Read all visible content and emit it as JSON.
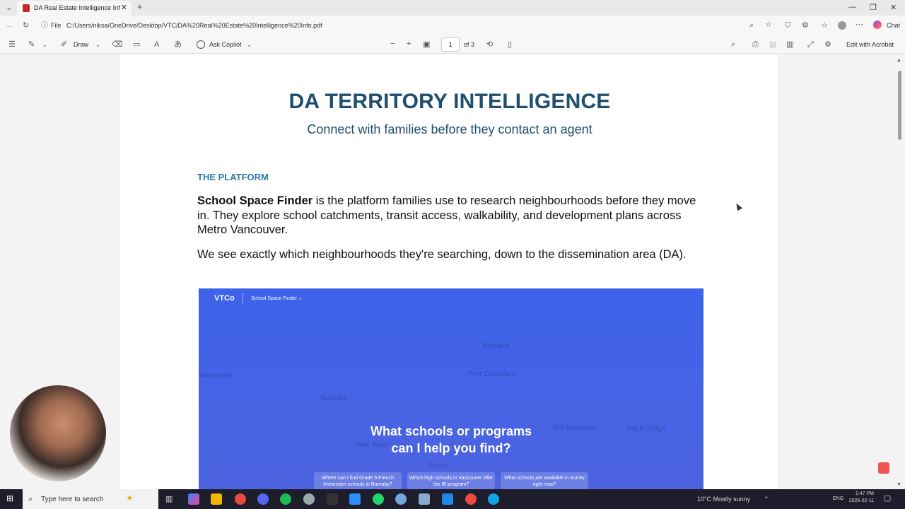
{
  "browser": {
    "tab_title": "DA Real Estate Intelligence Info.p",
    "tab_close": "✕",
    "new_tab": "+",
    "address_prefix": "File",
    "address_url": "C:/Users/niksa/OneDrive/Desktop/VTC/DA%20Real%20Estate%20Intelligence%20Info.pdf",
    "chat_label": "Chat"
  },
  "pdf_toolbar": {
    "draw_label": "Draw",
    "ask_copilot_label": "Ask Copilot",
    "page_current": "1",
    "page_total": "of 3",
    "edit_acrobat_label": "Edit with Acrobat"
  },
  "document": {
    "title": "DA TERRITORY INTELLIGENCE",
    "subtitle": "Connect with families before they contact an agent",
    "section_heading": "THE PLATFORM",
    "para1_bold": "School Space Finder",
    "para1_rest": " is the platform families use to research neighbourhoods before they move in. They explore school catchments, transit access, walkability, and development plans across Metro Vancouver.",
    "para2": "We see exactly which neighbourhoods they're searching, down to the dissemination area (DA).",
    "hero": {
      "logo": "VTCo",
      "nav": "School Space Finder ⌄",
      "question_line1": "What schools or programs",
      "question_line2": "can I help you find?",
      "map_labels": [
        "Vancouver",
        "Burnaby",
        "Port Coquitlam",
        "Pitt Meadows",
        "Maple Ridge",
        "New West",
        "Surrey",
        "Belcarra"
      ],
      "chips": [
        "Where can I find Grade 5 French Immersion schools in Burnaby?",
        "Which high schools in Vancouver offer the IB program?",
        "What schools are available in Surrey right now?"
      ]
    }
  },
  "taskbar": {
    "search_placeholder": "Type here to search",
    "weather": "10°C  Mostly sunny",
    "lang": "ENG",
    "time": "1:47 PM",
    "date": "2026-02-11"
  }
}
